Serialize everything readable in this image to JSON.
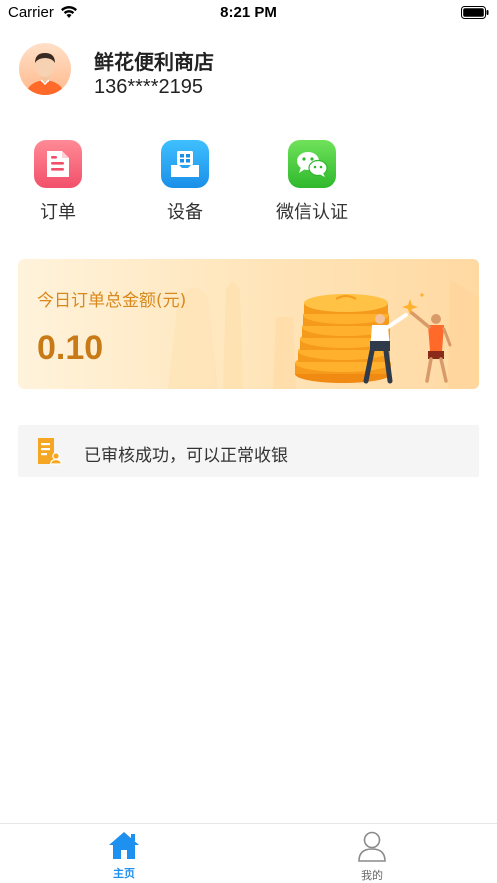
{
  "status_bar": {
    "carrier": "Carrier",
    "time": "8:21 PM"
  },
  "profile": {
    "store_name": "鲜花便利商店",
    "phone": "136****2195"
  },
  "menu": [
    {
      "label": "订单",
      "icon": "document-icon",
      "color": "#f2506a"
    },
    {
      "label": "设备",
      "icon": "pos-device-icon",
      "color": "#1a8fe8"
    },
    {
      "label": "微信认证",
      "icon": "wechat-icon",
      "color": "#2fb82c"
    }
  ],
  "amount_card": {
    "title": "今日订单总金额(元)",
    "value": "0.10"
  },
  "notice": {
    "text": "已审核成功，可以正常收银",
    "icon": "audit-document-icon"
  },
  "tab_bar": {
    "tabs": [
      {
        "label": "主页",
        "icon": "home-icon",
        "active": true
      },
      {
        "label": "我的",
        "icon": "user-icon",
        "active": false
      }
    ]
  },
  "colors": {
    "accent_blue": "#1e90f0",
    "amount_text": "#c87a16",
    "card_bg": "#ffe4b8"
  }
}
